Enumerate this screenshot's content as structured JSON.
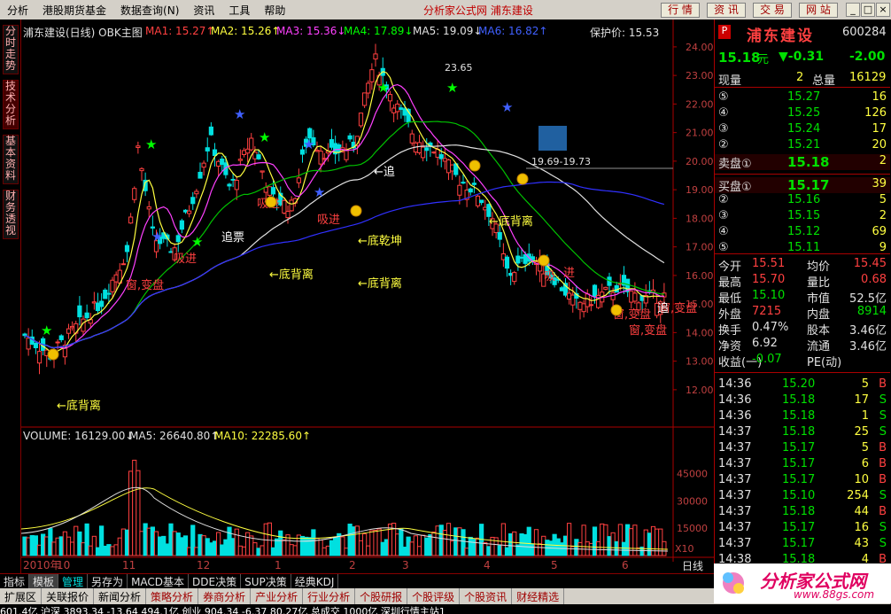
{
  "menu": {
    "items": [
      "分析",
      "港股期货基金",
      "数据查询(N)",
      "资讯",
      "工具",
      "帮助"
    ],
    "center": "分析家公式网  浦东建设",
    "buttons": [
      "行 情",
      "资 讯",
      "交 易",
      "网 站"
    ]
  },
  "left_tabs": [
    "分时走势",
    "技术分析",
    "基本资料",
    "财务透视"
  ],
  "chart": {
    "stock_title": "浦东建设(日线) OBK主图",
    "ma": [
      {
        "label": "MA1: 15.27↑",
        "color": "#ff4040"
      },
      {
        "label": "MA2: 15.26↑",
        "color": "#ffff40"
      },
      {
        "label": "MA3: 15.36↓",
        "color": "#ff40ff"
      },
      {
        "label": "MA4: 17.89↓",
        "color": "#00ff00"
      },
      {
        "label": "MA5: 19.09↓",
        "color": "#e0e0e0"
      },
      {
        "label": "MA6: 16.82↑",
        "color": "#4040ff"
      }
    ],
    "protect_label": "保护价: 15.53",
    "price_ticks": [
      "24.00",
      "23.00",
      "22.00",
      "21.00",
      "20.00",
      "19.00",
      "18.00",
      "17.00",
      "16.00",
      "15.00",
      "14.00",
      "13.00",
      "12.00"
    ],
    "vol_header": [
      {
        "label": "VOLUME: 16129.00↓",
        "color": "#e0e0e0"
      },
      {
        "label": "MA5: 26640.80↑",
        "color": "#e0e0e0"
      },
      {
        "label": "MA10: 22285.60↑",
        "color": "#ffff40"
      }
    ],
    "vol_ticks": [
      "45000",
      "30000",
      "15000"
    ],
    "vol_unit": "X10",
    "months": [
      "2010年",
      "10",
      "11",
      "12",
      "1",
      "2",
      "3",
      "4",
      "5",
      "6"
    ],
    "period_label": "日线",
    "high_label": "23.65",
    "range_label": "19.69-19.73",
    "annotations": [
      {
        "text": "←底背离",
        "color": "#ffff40"
      },
      {
        "text": "←底背离",
        "color": "#ffff40"
      },
      {
        "text": "←底背离",
        "color": "#ffff40"
      },
      {
        "text": "←底背离",
        "color": "#ffff40"
      },
      {
        "text": "←底乾坤",
        "color": "#ffff40"
      },
      {
        "text": "←追",
        "color": "#ffffff"
      },
      {
        "text": "追票",
        "color": "#ffffff"
      },
      {
        "text": "吸进",
        "color": "#ff4040"
      },
      {
        "text": "窗,变盘",
        "color": "#ff4040"
      },
      {
        "text": "窗,变盘",
        "color": "#ff4040"
      },
      {
        "text": "窗,变盘",
        "color": "#ff4040"
      },
      {
        "text": "窗,变盘",
        "color": "#ff4040"
      },
      {
        "text": "吸",
        "color": "#ff4040"
      },
      {
        "text": "进",
        "color": "#ff4040"
      },
      {
        "text": "吸进",
        "color": "#ff4040"
      },
      {
        "text": "吸进",
        "color": "#ff4040"
      },
      {
        "text": "追",
        "color": "#ffffff"
      }
    ]
  },
  "quote": {
    "name": "浦东建设",
    "code": "600284",
    "price": "15.18",
    "unit": "元",
    "change": "▼-0.31",
    "change2": "-2.00",
    "now_label": "现量",
    "now_val": "2",
    "total_label": "总量",
    "total_val": "16129",
    "asks": [
      {
        "n": "⑤",
        "p": "15.27",
        "v": "16"
      },
      {
        "n": "④",
        "p": "15.25",
        "v": "126"
      },
      {
        "n": "③",
        "p": "15.24",
        "v": "17"
      },
      {
        "n": "②",
        "p": "15.21",
        "v": "20"
      },
      {
        "n": "卖盘①",
        "p": "15.18",
        "v": "2"
      }
    ],
    "bids": [
      {
        "n": "买盘①",
        "p": "15.17",
        "v": "39"
      },
      {
        "n": "②",
        "p": "15.16",
        "v": "5"
      },
      {
        "n": "③",
        "p": "15.15",
        "v": "2"
      },
      {
        "n": "④",
        "p": "15.12",
        "v": "69"
      },
      {
        "n": "⑤",
        "p": "15.11",
        "v": "9"
      }
    ],
    "stats": [
      [
        "今开",
        "15.51",
        "均价",
        "15.45"
      ],
      [
        "最高",
        "15.70",
        "量比",
        "0.68"
      ],
      [
        "最低",
        "15.10",
        "市值",
        "52.5亿"
      ],
      [
        "外盘",
        "7215",
        "内盘",
        "8914"
      ],
      [
        "换手",
        "0.47%",
        "股本",
        "3.46亿"
      ],
      [
        "净资",
        "6.92",
        "流通",
        "3.46亿"
      ],
      [
        "收益(一)",
        "-0.07",
        "PE(动)",
        ""
      ]
    ],
    "ticks": [
      [
        "14:36",
        "15.20",
        "5",
        "B"
      ],
      [
        "14:36",
        "15.18",
        "17",
        "S"
      ],
      [
        "14:36",
        "15.18",
        "1",
        "S"
      ],
      [
        "14:37",
        "15.18",
        "25",
        "S"
      ],
      [
        "14:37",
        "15.17",
        "5",
        "B"
      ],
      [
        "14:37",
        "15.17",
        "6",
        "B"
      ],
      [
        "14:37",
        "15.17",
        "10",
        "B"
      ],
      [
        "14:37",
        "15.10",
        "254",
        "S"
      ],
      [
        "14:37",
        "15.18",
        "44",
        "B"
      ],
      [
        "14:37",
        "15.17",
        "16",
        "S"
      ],
      [
        "14:37",
        "15.17",
        "43",
        "S"
      ],
      [
        "14:38",
        "15.18",
        "4",
        "B"
      ]
    ]
  },
  "tabs1": [
    "指标",
    "模板",
    "管理",
    "另存为",
    "MACD基本",
    "DDE决策",
    "SUP决策",
    "经典KDJ"
  ],
  "tabs2": [
    "扩展区",
    "关联报价",
    "新闻分析",
    "策略分析",
    "券商分析",
    "产业分析",
    "行业分析",
    "个股研报",
    "个股评级",
    "个股资讯",
    "财经精选"
  ],
  "tabs2_right": "资讯工场",
  "status": "601.4亿 沪深 3893.34 -13.64 494.1亿 创业 904.34 -6.37 80.27亿 总成交 1000亿 深圳行情主站1",
  "logo_text": "分析家公式网",
  "logo_url": "www.88gs.com",
  "colors": {
    "up": "#ff4040",
    "down": "#00e0e0",
    "bg": "#000000"
  }
}
